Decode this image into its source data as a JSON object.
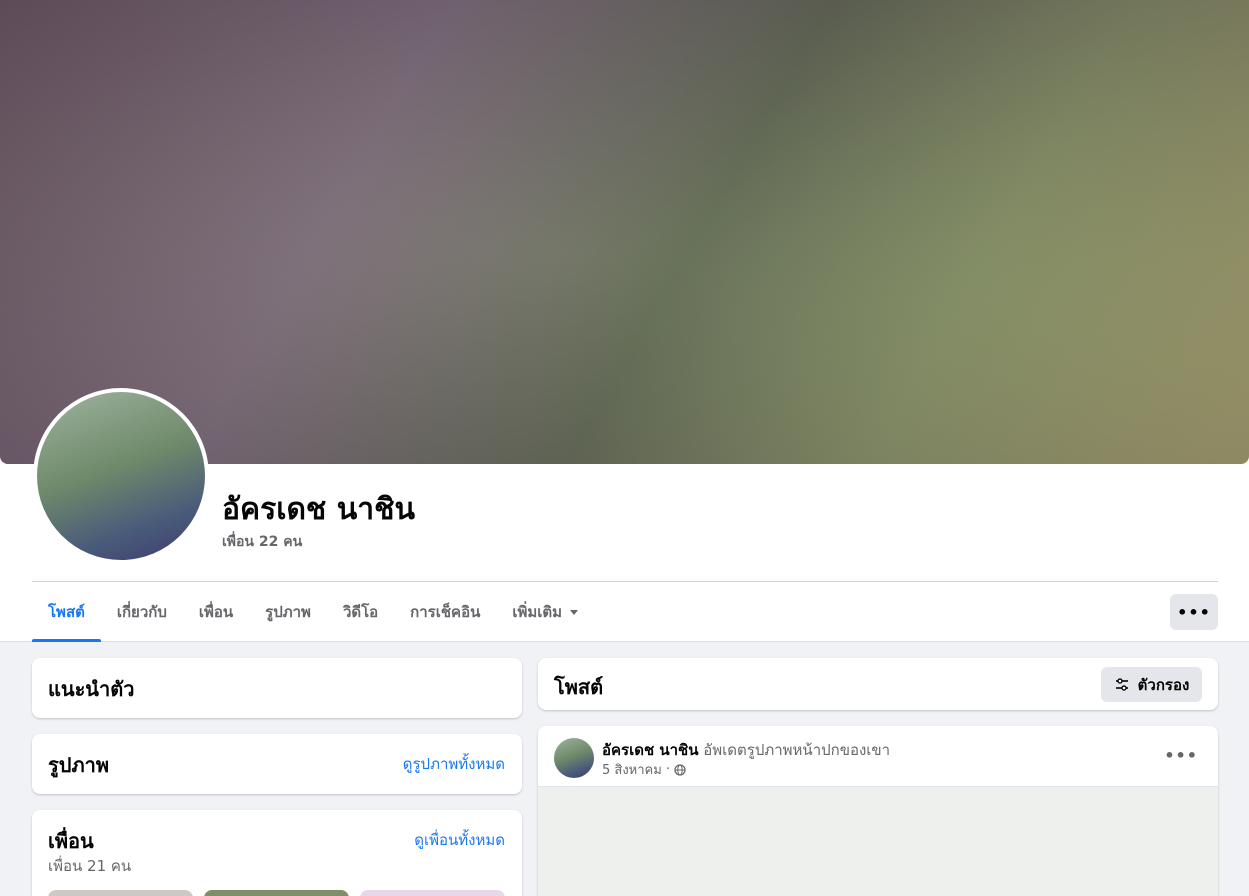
{
  "profile": {
    "name": "อัครเดช นาชิน",
    "friends_count": "เพื่อน 22 คน"
  },
  "tabs": [
    {
      "label": "โพสต์"
    },
    {
      "label": "เกี่ยวกับ"
    },
    {
      "label": "เพื่อน"
    },
    {
      "label": "รูปภาพ"
    },
    {
      "label": "วิดีโอ"
    },
    {
      "label": "การเช็คอิน"
    },
    {
      "label": "เพิ่มเติม"
    }
  ],
  "more_button": "•••",
  "intro": {
    "title": "แนะนำตัว"
  },
  "photos": {
    "title": "รูปภาพ",
    "see_all": "ดูรูปภาพทั้งหมด"
  },
  "friends": {
    "title": "เพื่อน",
    "count": "เพื่อน 21 คน",
    "see_all": "ดูเพื่อนทั้งหมด"
  },
  "posts": {
    "title": "โพสต์",
    "filter_label": "ตัวกรอง"
  },
  "post": {
    "author": "อัครเดช นาชิน",
    "action": "อัพเดตรูปภาพหน้าปกของเขา",
    "date": "5 สิงหาคม",
    "separator": "·",
    "menu": "•••"
  },
  "colors": {
    "accent": "#1877f2",
    "background": "#f0f2f5",
    "card": "#ffffff",
    "secondary_text": "#65676b"
  },
  "icons": [
    "globe-icon",
    "filter-icon",
    "caret-down-icon",
    "more-icon"
  ]
}
